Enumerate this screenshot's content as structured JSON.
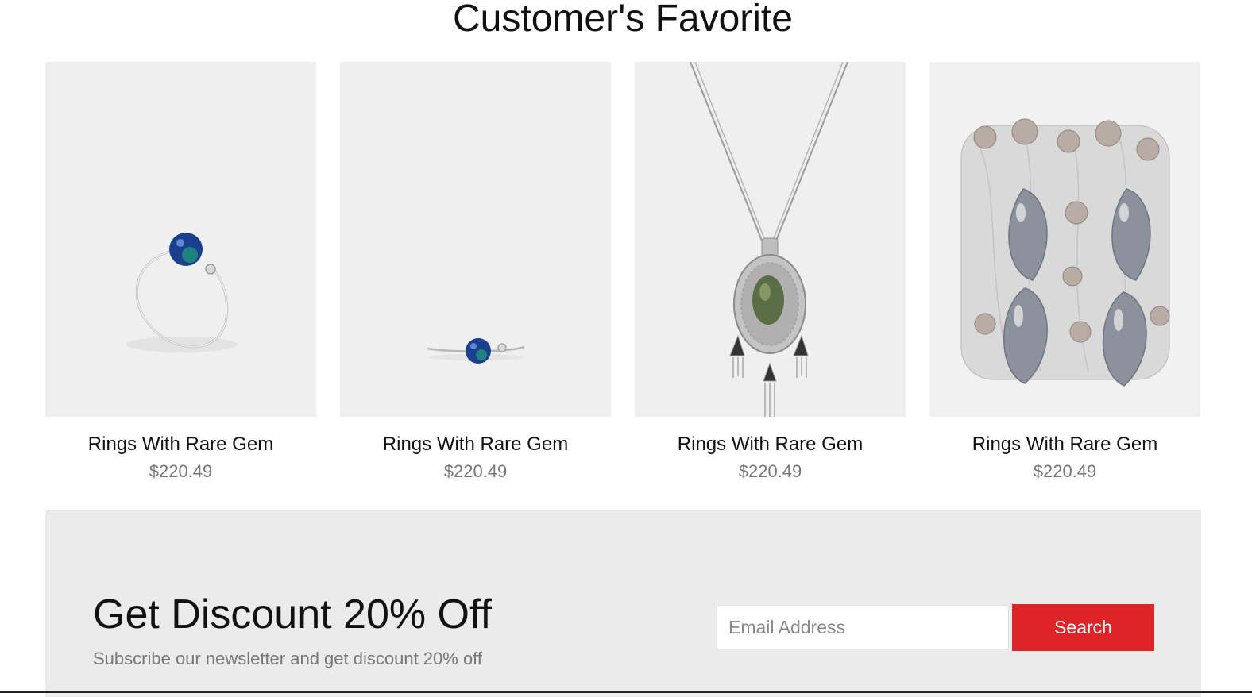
{
  "section": {
    "title": "Customer's Favorite"
  },
  "products": [
    {
      "name": "Rings With Rare Gem",
      "price": "$220.49",
      "image_icon": "ring-bangle-image"
    },
    {
      "name": "Rings With Rare Gem",
      "price": "$220.49",
      "image_icon": "ring-small-image"
    },
    {
      "name": "Rings With Rare Gem",
      "price": "$220.49",
      "image_icon": "pendant-necklace-image"
    },
    {
      "name": "Rings With Rare Gem",
      "price": "$220.49",
      "image_icon": "crystal-cuff-bracelet-image"
    }
  ],
  "newsletter": {
    "heading": "Get Discount 20% Off",
    "subtext": "Subscribe our newsletter and get discount 20% off",
    "email_placeholder": "Email Address",
    "email_value": "",
    "button_label": "Search"
  },
  "colors": {
    "accent": "#de2426",
    "newsletter_bg": "#ebebeb",
    "image_bg": "#efefef",
    "price_text": "#777777"
  }
}
